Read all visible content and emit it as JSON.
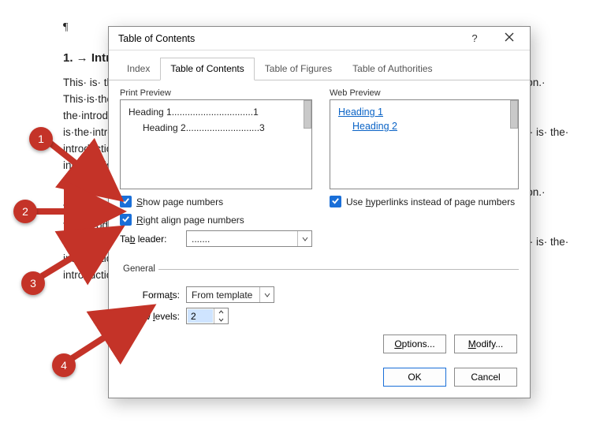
{
  "document": {
    "pilcrow": "¶",
    "heading": "1. → Introduction¶",
    "para": "This· is· the· introduction.· This·is·the·introduction.· This·is·the·introduction.· This·is· the· introduction.· This·is·the·introduction.· This·is·the·introduction.· This·is·the·introduction.· This·is· the·introduction.·This·is·the·introduction.·This·is·the·introduction.·This·is·the·introduction.·This· is·the·introduction.· This·is·the·introduction.· This·is·the·introduction.· This·is·the·introduction.· This· is· the· introduction.· This·is·the·introduction.· This·is·the·introduction.· This·is· the· introduction.·This·is·the·introduction.¶",
    "para2": "This· is· the· introduction.· This·is·the·introduction.· This·is·the·introduction.· This·is· the· introduction.· This·is·the·introduction.· This·is·the·introduction.· This·is·the·introduction.· This·is· the·introduction.·This·is·the·introduction.·This·is·the·introduction.·This·is·the·introduction.·This· is·the·introduction.· This·is·the·introduction.· This·is·the·introduction.· This·is·the·introduction.· This· is· the· introduction.· This·is·the·introduction.· This·is·the·introduction.· This·is· the· introduction.·This·is·the·introduction.·This·is·the·introduction.·This·is·the·introduction.¶"
  },
  "dialog": {
    "title": "Table of Contents",
    "help": "?",
    "tabs": [
      "Index",
      "Table of Contents",
      "Table of Figures",
      "Table of Authorities"
    ],
    "active_tab": 1,
    "print_preview": {
      "label": "Print Preview",
      "line1": "Heading 1...............................1",
      "line2": "Heading 2............................3"
    },
    "web_preview": {
      "label": "Web Preview",
      "link1": "Heading 1",
      "link2": "Heading 2"
    },
    "show_page_numbers": {
      "checked": true,
      "label": "Show page numbers"
    },
    "right_align": {
      "checked": true,
      "label": "Right align page numbers"
    },
    "tab_leader": {
      "label": "Tab leader:",
      "value": "......."
    },
    "use_hyperlinks": {
      "checked": true,
      "label": "Use hyperlinks instead of page numbers"
    },
    "general_legend": "General",
    "formats": {
      "label": "Formats:",
      "value": "From template"
    },
    "show_levels": {
      "label": "Show levels:",
      "value": "2"
    },
    "options_btn": "Options...",
    "modify_btn": "Modify...",
    "ok_btn": "OK",
    "cancel_btn": "Cancel"
  },
  "annotations": {
    "n1": "1",
    "n2": "2",
    "n3": "3",
    "n4": "4"
  }
}
